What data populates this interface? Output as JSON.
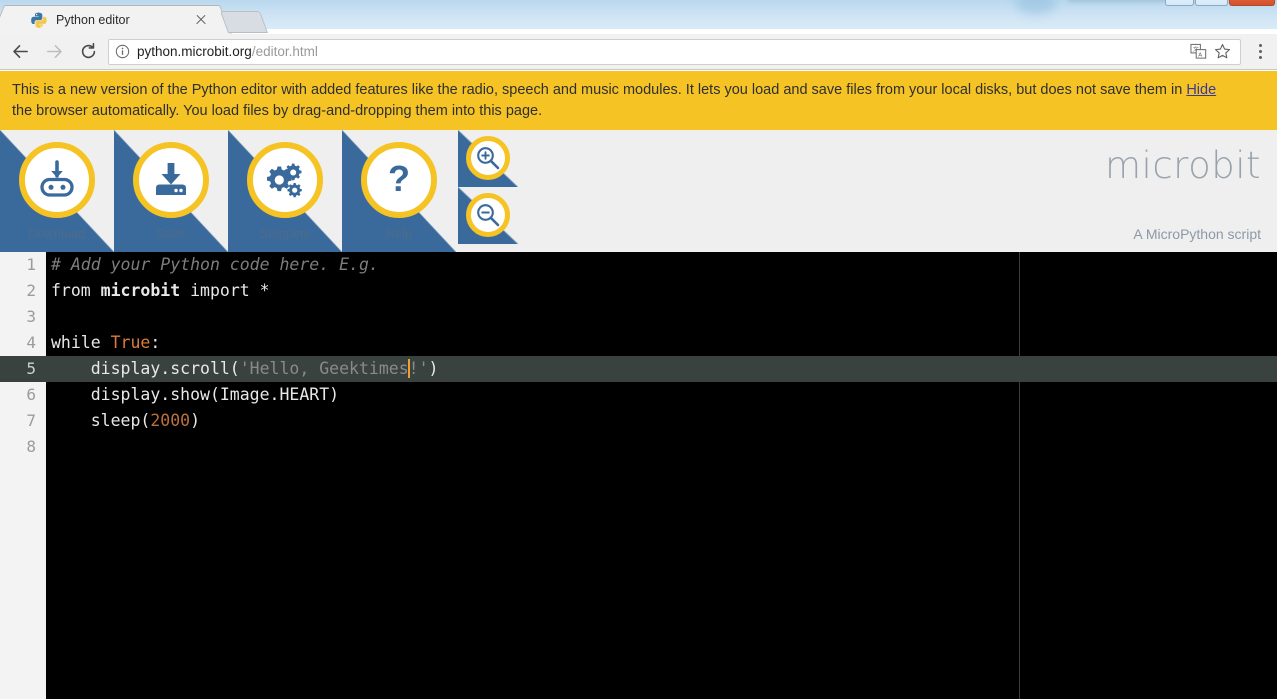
{
  "window": {
    "controls": [
      "minimize",
      "maximize",
      "close"
    ]
  },
  "browser": {
    "tab": {
      "title": "Python editor",
      "favicon": "python-logo-icon",
      "close_icon": "close-icon"
    },
    "new_tab_label": "",
    "nav": {
      "back_icon": "back-arrow-icon",
      "forward_icon": "forward-arrow-icon",
      "reload_icon": "reload-icon"
    },
    "omnibox": {
      "security_icon": "info-circle-icon",
      "url_host": "python.microbit.org",
      "url_path": "/editor.html",
      "translate_icon": "translate-icon",
      "bookmark_icon": "star-icon"
    },
    "menu_icon": "three-dots-menu-icon"
  },
  "banner": {
    "text_before_link": "This is a new version of the Python editor with added features like the radio, speech and music modules. It lets you load and save files from your local disks, but does not save them in ",
    "link_label": "Hide",
    "text_after_link": "the browser automatically. You load files by drag-and-dropping them into this page.",
    "background_color": "#f5c324"
  },
  "header": {
    "accent_color": "#f5c324",
    "blue_color": "#3a6a9c",
    "buttons": [
      {
        "label": "Download",
        "icon": "microbit-download-icon"
      },
      {
        "label": "Save",
        "icon": "save-download-tray-icon"
      },
      {
        "label": "Snippets",
        "icon": "gears-icon"
      },
      {
        "label": "Help",
        "icon": "question-mark-icon"
      }
    ],
    "zoom_buttons": [
      {
        "icon": "zoom-in-magnifier-icon",
        "name": "zoom-in"
      },
      {
        "icon": "zoom-out-magnifier-icon",
        "name": "zoom-out"
      }
    ],
    "brand": "microbit",
    "brand_subtitle": "A MicroPython script"
  },
  "editor": {
    "active_line": 5,
    "line_count": 8,
    "line_numbers": [
      "1",
      "2",
      "3",
      "4",
      "5",
      "6",
      "7",
      "8"
    ],
    "lines": [
      "# Add your Python code here. E.g.",
      "from microbit import *",
      "",
      "while True:",
      "    display.scroll('Hello, Geektimes!')",
      "    display.show(Image.HEART)",
      "    sleep(2000)",
      ""
    ],
    "cursor_line": 5,
    "cursor_after_text": "Hello, Geektimes",
    "background_color": "#000000",
    "active_line_color": "#3a423f",
    "gutter_color": "#f3f3f3"
  }
}
